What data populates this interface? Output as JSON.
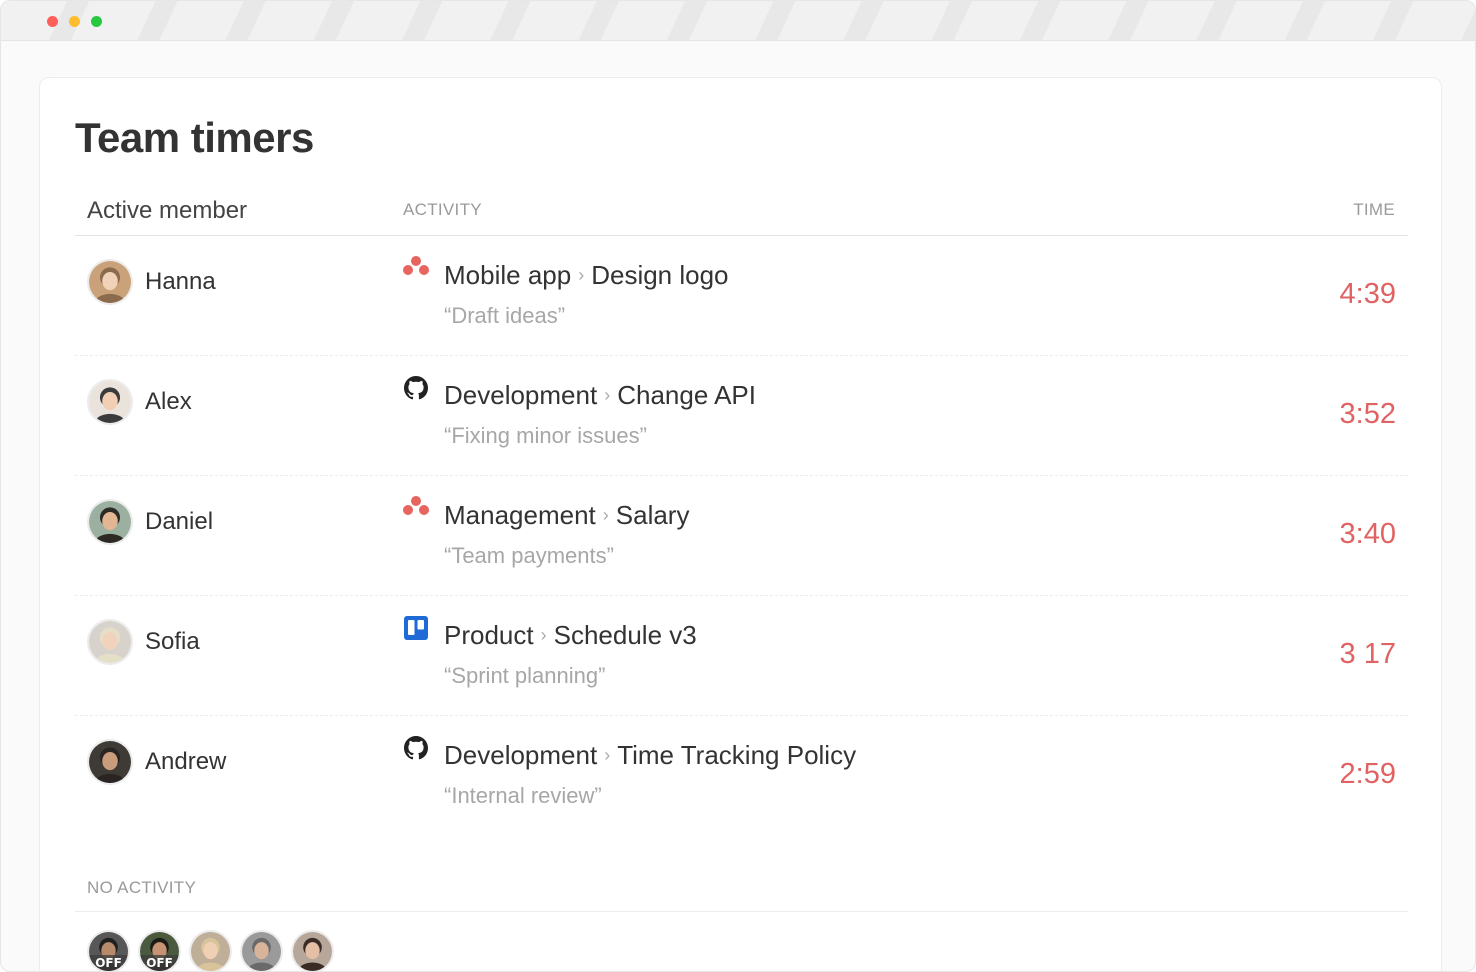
{
  "window": {
    "controls": [
      "close",
      "minimize",
      "zoom"
    ]
  },
  "page": {
    "title": "Team timers"
  },
  "table": {
    "headers": {
      "member": "Active member",
      "activity": "ACTIVITY",
      "time": "TIME"
    },
    "rows": [
      {
        "name": "Hanna",
        "app_icon": "asana-icon",
        "project": "Mobile app",
        "separator": "›",
        "task": "Design logo",
        "note": "“Draft ideas”",
        "time": "4:39",
        "avatar_colors": [
          "#c9a27a",
          "#f0d2b8",
          "#8c6a4c"
        ]
      },
      {
        "name": "Alex",
        "app_icon": "github-icon",
        "project": "Development",
        "separator": "›",
        "task": "Change API",
        "note": "“Fixing minor issues”",
        "time": "3:52",
        "avatar_colors": [
          "#e9e3dc",
          "#f2cfb4",
          "#3b3b3b"
        ]
      },
      {
        "name": "Daniel",
        "app_icon": "asana-icon",
        "project": "Management",
        "separator": "›",
        "task": "Salary",
        "note": "“Team payments”",
        "time": "3:40",
        "avatar_colors": [
          "#9bb0a0",
          "#e2b692",
          "#2d2a26"
        ]
      },
      {
        "name": "Sofia",
        "app_icon": "trello-icon",
        "project": "Product",
        "separator": "›",
        "task": "Schedule v3",
        "note": "“Sprint planning”",
        "time": "3 17",
        "avatar_colors": [
          "#d7d2cb",
          "#f1d3bd",
          "#e6dfc8"
        ]
      },
      {
        "name": "Andrew",
        "app_icon": "github-icon",
        "project": "Development",
        "separator": "›",
        "task": "Time Tracking Policy",
        "note": "“Internal review”",
        "time": "2:59",
        "avatar_colors": [
          "#3e3a36",
          "#c99c7c",
          "#2a2522"
        ]
      }
    ]
  },
  "no_activity": {
    "label": "NO ACTIVITY",
    "members": [
      {
        "badge": "OFF",
        "colors": [
          "#575757",
          "#b88a6c",
          "#1f1f1f"
        ]
      },
      {
        "badge": "OFF",
        "colors": [
          "#4a5a3e",
          "#c69474",
          "#1d1a17"
        ]
      },
      {
        "badge": "",
        "colors": [
          "#bfae98",
          "#efd0b4",
          "#d8c39a"
        ]
      },
      {
        "badge": "",
        "colors": [
          "#9a9a9a",
          "#d9b49a",
          "#6a6a6a"
        ]
      },
      {
        "badge": "",
        "colors": [
          "#b6a79a",
          "#e3bfa5",
          "#3a2c25"
        ]
      }
    ]
  },
  "colors": {
    "time_accent": "#e06262",
    "asana": "#e8655f",
    "trello": "#1f6ad6",
    "github": "#222222"
  }
}
